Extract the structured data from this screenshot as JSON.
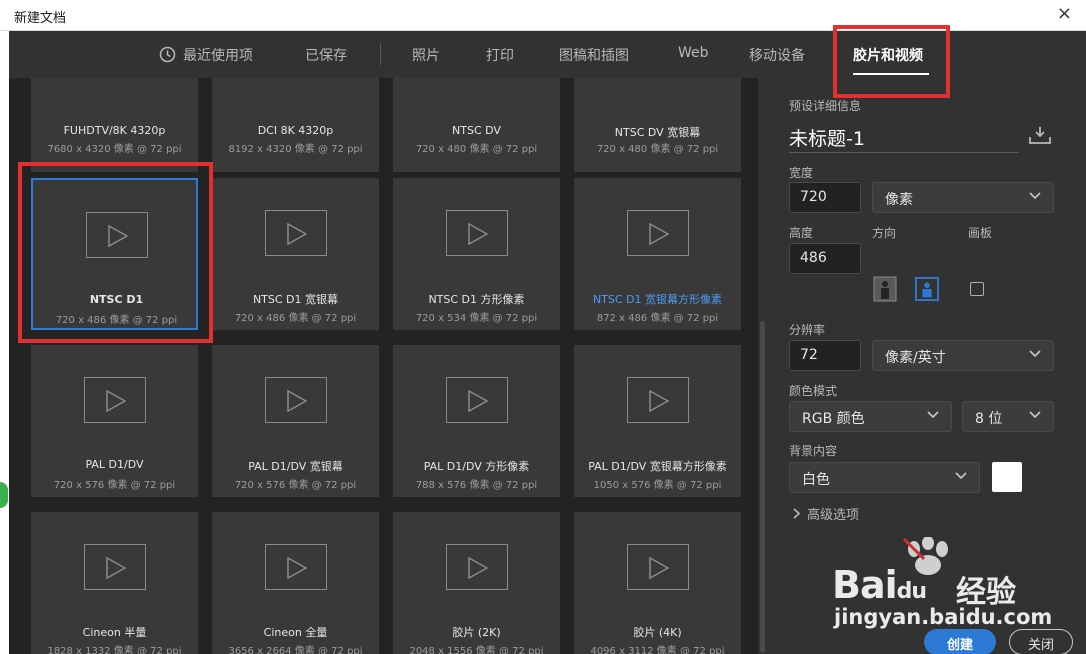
{
  "window": {
    "title": "新建文档",
    "close_symbol": "×"
  },
  "tabs": [
    {
      "label": "最近使用项",
      "active": false
    },
    {
      "label": "已保存",
      "active": false
    },
    {
      "label": "照片",
      "active": false
    },
    {
      "label": "打印",
      "active": false
    },
    {
      "label": "图稿和插图",
      "active": false
    },
    {
      "label": "Web",
      "active": false
    },
    {
      "label": "移动设备",
      "active": false
    },
    {
      "label": "胶片和视频",
      "active": true
    }
  ],
  "presets": [
    {
      "name": "FUHDTV/8K 4320p",
      "size": "7680 x 4320 像素 @ 72 ppi"
    },
    {
      "name": "DCI 8K 4320p",
      "size": "8192 x 4320 像素 @ 72 ppi"
    },
    {
      "name": "NTSC DV",
      "size": "720 x 480 像素 @ 72 ppi"
    },
    {
      "name": "NTSC DV 宽银幕",
      "size": "720 x 480 像素 @ 72 ppi"
    },
    {
      "name": "NTSC D1",
      "size": "720 x 486 像素 @ 72 ppi",
      "selected": true
    },
    {
      "name": "NTSC D1 宽银幕",
      "size": "720 x 486 像素 @ 72 ppi"
    },
    {
      "name": "NTSC D1 方形像素",
      "size": "720 x 534 像素 @ 72 ppi"
    },
    {
      "name": "NTSC D1 宽银幕方形像素",
      "size": "872 x 486 像素 @ 72 ppi",
      "highlight": true
    },
    {
      "name": "PAL D1/DV",
      "size": "720 x 576 像素 @ 72 ppi"
    },
    {
      "name": "PAL D1/DV 宽银幕",
      "size": "720 x 576 像素 @ 72 ppi"
    },
    {
      "name": "PAL D1/DV 方形像素",
      "size": "788 x 576 像素 @ 72 ppi"
    },
    {
      "name": "PAL D1/DV 宽银幕方形像素",
      "size": "1050 x 576 像素 @ 72 ppi"
    },
    {
      "name": "Cineon 半量",
      "size": "1828 x 1332 像素 @ 72 ppi"
    },
    {
      "name": "Cineon 全量",
      "size": "3656 x 2664 像素 @ 72 ppi"
    },
    {
      "name": "胶片 (2K)",
      "size": "2048 x 1556 像素 @ 72 ppi"
    },
    {
      "name": "胶片 (4K)",
      "size": "4096 x 3112 像素 @ 72 ppi"
    }
  ],
  "details": {
    "section_label": "预设详细信息",
    "doc_name": "未标题-1",
    "width_label": "宽度",
    "width_value": "720",
    "width_unit": "像素",
    "height_label": "高度",
    "height_value": "486",
    "orientation_label": "方向",
    "artboard_label": "画板",
    "resolution_label": "分辨率",
    "resolution_value": "72",
    "resolution_unit": "像素/英寸",
    "color_mode_label": "颜色模式",
    "color_mode": "RGB 颜色",
    "bit_depth": "8 位",
    "background_label": "背景内容",
    "background": "白色",
    "background_color": "#ffffff",
    "advanced_label": "高级选项"
  },
  "buttons": {
    "create": "创建",
    "close": "关闭"
  },
  "watermark": {
    "brand": "Bai",
    "brand_du": "du",
    "jingyan": "经验",
    "url": "jingyan.baidu.com"
  },
  "colors": {
    "accent": "#2d7ad6",
    "highlight_text": "#4c9bf5",
    "annotation_red": "#e0302f"
  }
}
